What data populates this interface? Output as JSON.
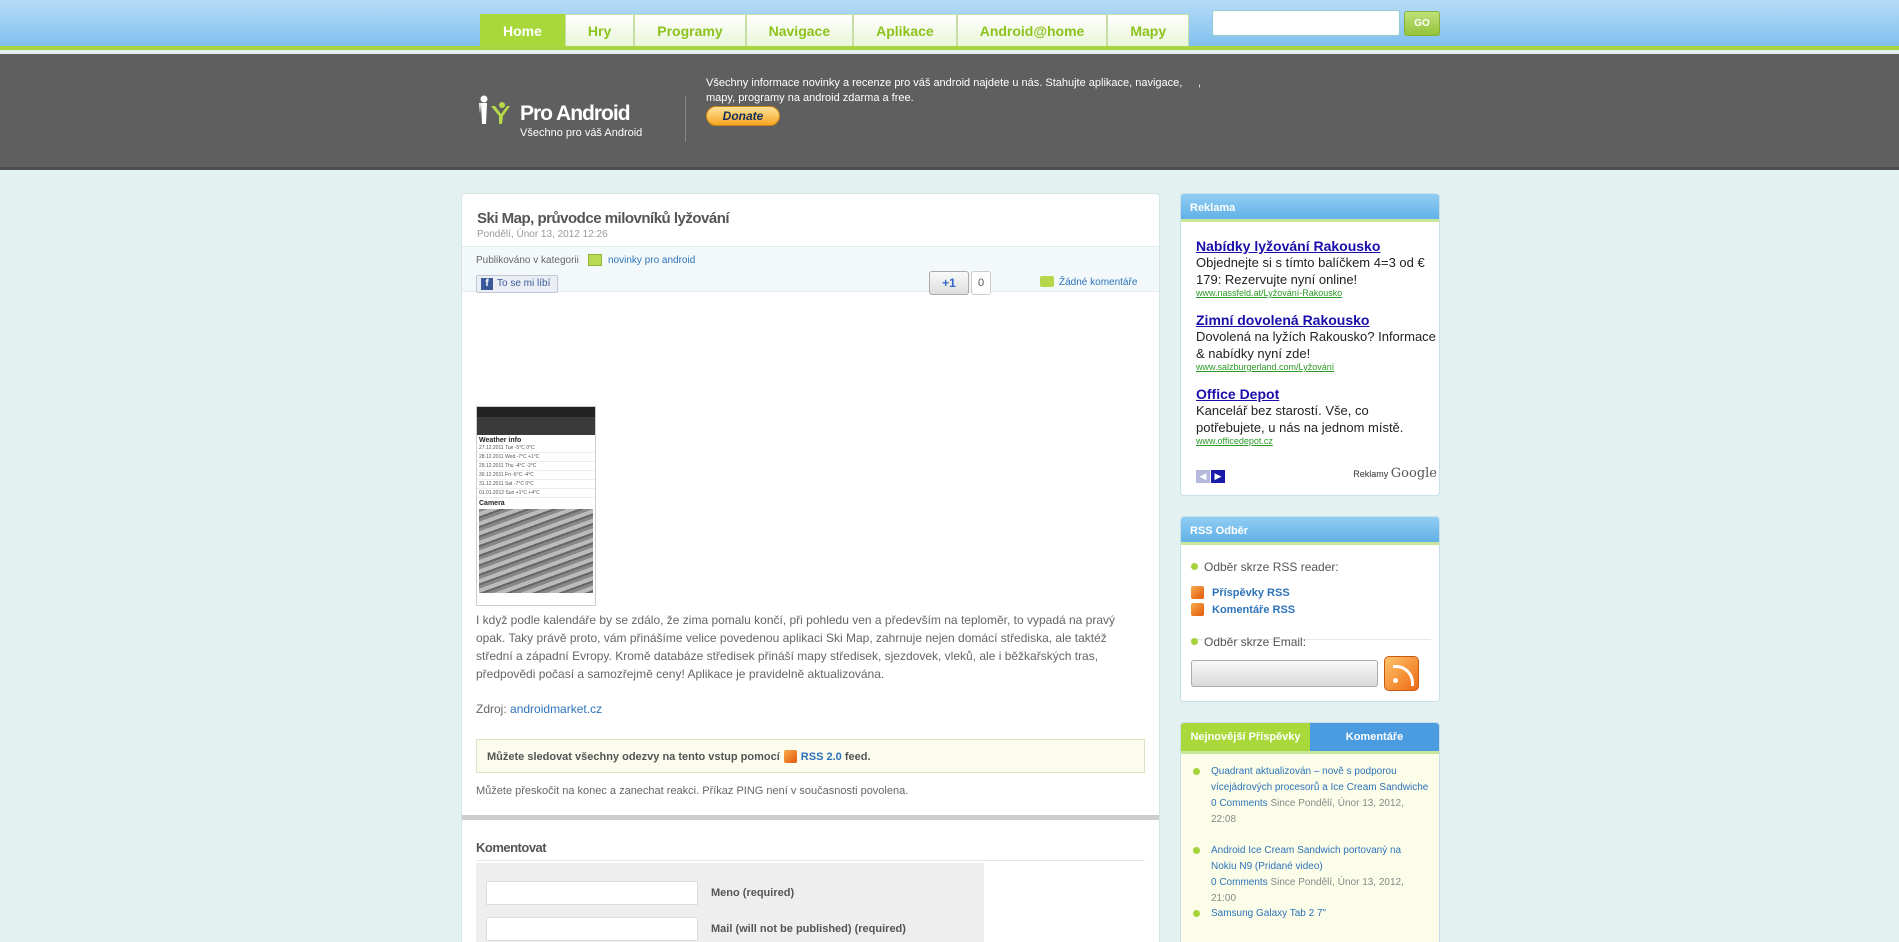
{
  "nav": {
    "items": [
      "Home",
      "Hry",
      "Programy",
      "Navigace",
      "Aplikace",
      "Android@home",
      "Mapy"
    ],
    "active": "Home",
    "search_placeholder": "",
    "go_label": "GO"
  },
  "header": {
    "site_title": "Pro Android",
    "tagline": "Všechno pro váš Android",
    "info": "Všechny informace novinky a recenze pro váš android najdete u nás. Stahujte aplikace, navigace, mapy, programy na android zdarma a free.",
    "info_comma": ",",
    "donate_label": "Donate"
  },
  "post": {
    "title": "Ski Map, průvodce milovníků lyžování",
    "date": "Pondělí, Únor 13, 2012 12:26",
    "published_in": "Publikováno v kategorii",
    "category": "novinky pro android",
    "like_label": "To se mi líbí",
    "plusone_label": "+1",
    "plusone_count": "0",
    "comments_link": "Žádné komentáře",
    "screenshot": {
      "weather_title": "Weather info",
      "weather_rows": [
        "27.12.2011 Tue  -5°C  0°C",
        "28.12.2011 Wed  -7°C  +1°C",
        "29.12.2011 Thu  -4°C  -2°C",
        "30.12.2011 Fri  -6°C  -4°C",
        "31.12.2011 Sat  -7°C  0°C",
        "01.01.2012 Sun  +1°C  +4°C"
      ],
      "camera_title": "Camera"
    },
    "body": "I když podle kalendáře by se zdálo, že zima pomalu končí, při pohledu ven a především na teploměr, to vypadá na pravý opak. Taky právě proto, vám přinášíme velice povedenou aplikaci Ski Map, zahrnuje nejen domácí střediska, ale taktéž střední a západní Evropy. Kromě databáze středisek přináší mapy středisek, sjezdovek, vleků, ale i běžkařských tras, předpovědi počasí a samozřejmě ceny! Aplikace je pravidelně aktualizována.",
    "source_label": "Zdroj:",
    "source_link": "androidmarket.cz",
    "follow_text": "Můžete sledovat všechny odezvy na tento vstup pomocí",
    "follow_link": "RSS 2.0",
    "follow_suffix": "feed.",
    "skip_text": "Můžete přeskočit na konec a zanechat reakci. Příkaz PING není v současnosti povolena."
  },
  "comment_form": {
    "heading": "Komentovat",
    "name_label": "Meno (required)",
    "mail_label": "Mail (will not be published) (required)"
  },
  "sidebar": {
    "ads_title": "Reklama",
    "ads": [
      {
        "title": "Nabídky lyžování Rakousko",
        "text": "Objednejte si s tímto balíčkem 4=3 od € 179: Rezervujte nyní online!",
        "url": "www.nassfeld.at/Lyžování-Rakousko"
      },
      {
        "title": "Zimní dovolená Rakousko",
        "text": "Dovolená na lyžích Rakousko? Informace & nabídky nyní zde!",
        "url": "www.salzburgerland.com/Lyžování"
      },
      {
        "title": "Office Depot",
        "text": "Kancelář bez starostí. Vše, co potřebujete, u nás na jednom místě.",
        "url": "www.officedepot.cz"
      }
    ],
    "ads_footer": "Reklamy",
    "ads_brand": "Google",
    "rss_title": "RSS Odběr",
    "rss_reader": "Odběr skrze RSS reader:",
    "rss_posts": "Příspěvky RSS",
    "rss_comments": "Komentáře RSS",
    "rss_email": "Odběr skrze Email:",
    "tab_recent": "Nejnovější Příspěvky",
    "tab_comments": "Komentáře",
    "recent": [
      {
        "title": "Quadrant aktualizován – nově s podporou vícejádrových procesorů a Ice Cream Sandwiche",
        "comments": "0 Comments",
        "since": "Since Pondělí, Únor 13, 2012, 22:08"
      },
      {
        "title": "Android Ice Cream Sandwich portovaný na Nokiu N9 (Pridané video)",
        "comments": "0 Comments",
        "since": "Since Pondělí, Únor 13, 2012, 21:00"
      },
      {
        "title": "Samsung Galaxy Tab 2 7\"",
        "comments": "",
        "since": ""
      }
    ]
  }
}
